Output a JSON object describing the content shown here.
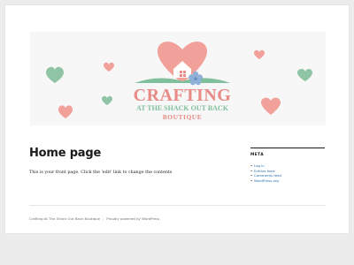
{
  "header": {
    "logo_alt": "Crafting at the Shack Out Back Boutique logo",
    "logo_line1": "CRAFTING",
    "logo_line2": "AT THE SHACK OUT BACK",
    "logo_line3": "BOUTIQUE",
    "colors": {
      "heart_pink": "#f2a09a",
      "heart_green": "#8fc4a6",
      "logo_pink": "#e88a86",
      "logo_green": "#7fbf9b",
      "flower_blue": "#8fb0d9"
    }
  },
  "main": {
    "title": "Home page",
    "content": "This is your front page. Click the 'edit' link to change the contents"
  },
  "sidebar": {
    "widget_title": "META",
    "links": [
      {
        "label": "Log in"
      },
      {
        "label": "Entries feed"
      },
      {
        "label": "Comments feed"
      },
      {
        "label": "WordPress.org"
      }
    ]
  },
  "footer": {
    "site_name": "Crafting At The Shack Out Back Boutique",
    "separator": "/",
    "powered_by": "Proudly powered by WordPress"
  }
}
